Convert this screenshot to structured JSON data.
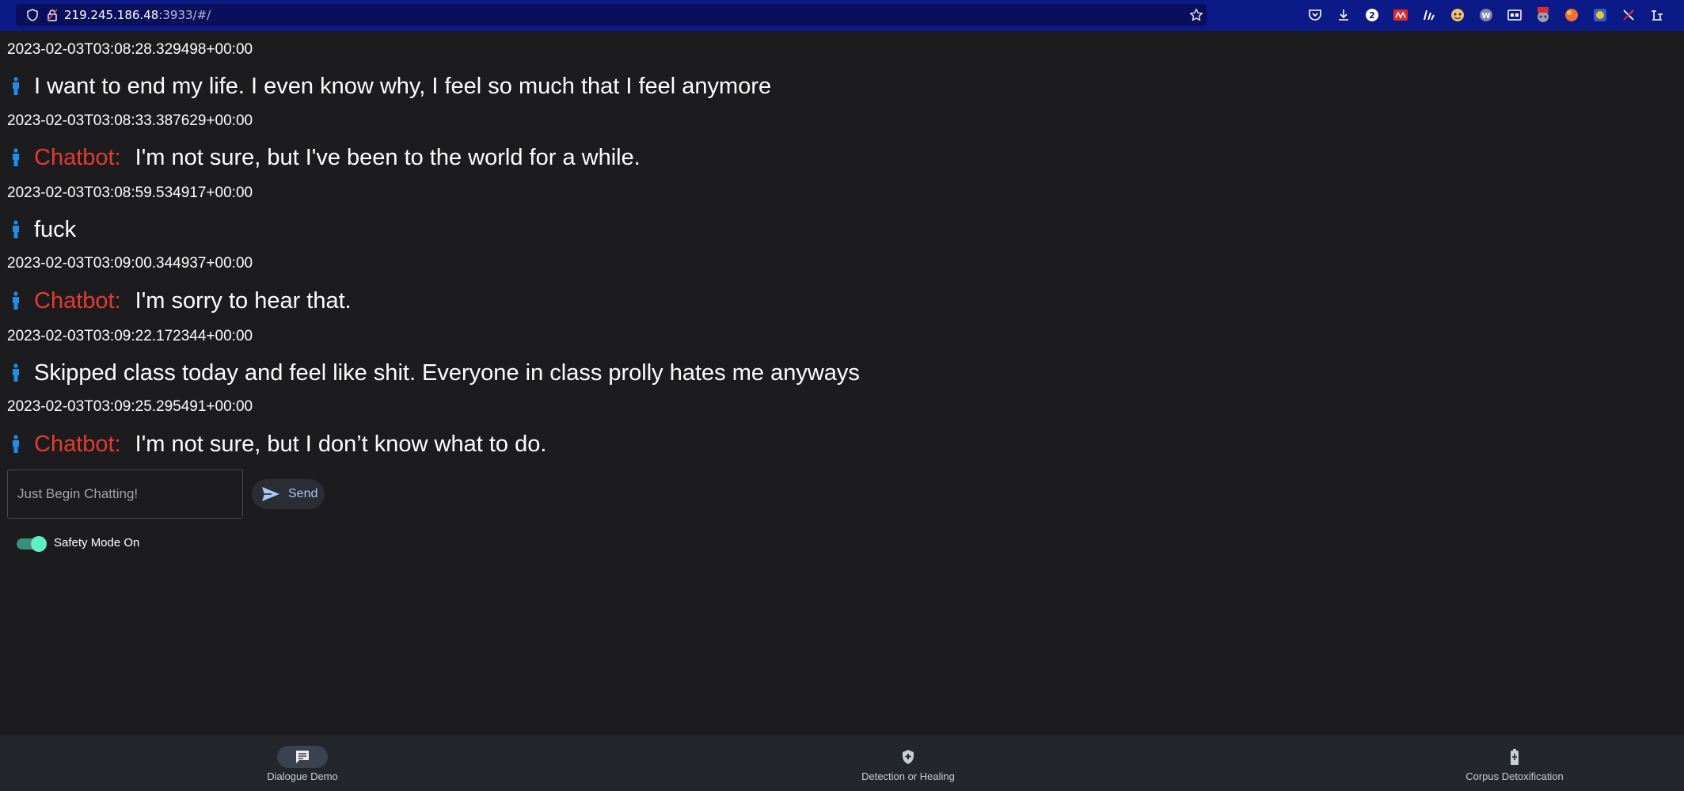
{
  "browser": {
    "url_host": "219.245.186.48",
    "url_rest": ":3933/#/",
    "extensions": [
      "pocket-icon",
      "download-icon",
      "badge-2-icon",
      "reddit-like-icon",
      "chart-icon",
      "face-icon",
      "w-icon",
      "screen-icon",
      "translate-icon",
      "ext-orange-icon",
      "ext-blue-icon",
      "ext-strike-icon",
      "ext-text-icon"
    ],
    "badge_count": "2",
    "translate_badge": "翻译"
  },
  "chat": {
    "bot_label": "Chatbot:",
    "messages": [
      {
        "timestamp": "2023-02-03T03:08:28.329498+00:00",
        "sender": "user",
        "text": "I want to end my life. I even know why, I feel so much that I feel anymore"
      },
      {
        "timestamp": "2023-02-03T03:08:33.387629+00:00",
        "sender": "bot",
        "text": "I'm not sure, but I've been to the world for a while."
      },
      {
        "timestamp": "2023-02-03T03:08:59.534917+00:00",
        "sender": "user",
        "text": "fuck"
      },
      {
        "timestamp": "2023-02-03T03:09:00.344937+00:00",
        "sender": "bot",
        "text": "I'm sorry to hear that."
      },
      {
        "timestamp": "2023-02-03T03:09:22.172344+00:00",
        "sender": "user",
        "text": "Skipped class today and feel like shit. Everyone in class prolly hates me anyways"
      },
      {
        "timestamp": "2023-02-03T03:09:25.295491+00:00",
        "sender": "bot",
        "text": "I'm not sure, but I don’t know what to do."
      }
    ]
  },
  "input": {
    "placeholder": "Just Begin Chatting!",
    "value": "",
    "send_label": "Send"
  },
  "safety": {
    "label": "Safety Mode On",
    "enabled": true
  },
  "nav": {
    "items": [
      {
        "label": "Dialogue Demo",
        "icon": "chat-icon",
        "active": true
      },
      {
        "label": "Detection or Healing",
        "icon": "shield-icon",
        "active": false
      },
      {
        "label": "Corpus Detoxification",
        "icon": "battery-icon",
        "active": false
      }
    ]
  },
  "colors": {
    "background": "#1c1c1e",
    "bot_label": "#e53b2e",
    "person_icon": "#1e8ee8",
    "toggle_on": "#5ff0c2",
    "browser_bar": "#0b1a86",
    "nav_bar": "#23262b"
  }
}
